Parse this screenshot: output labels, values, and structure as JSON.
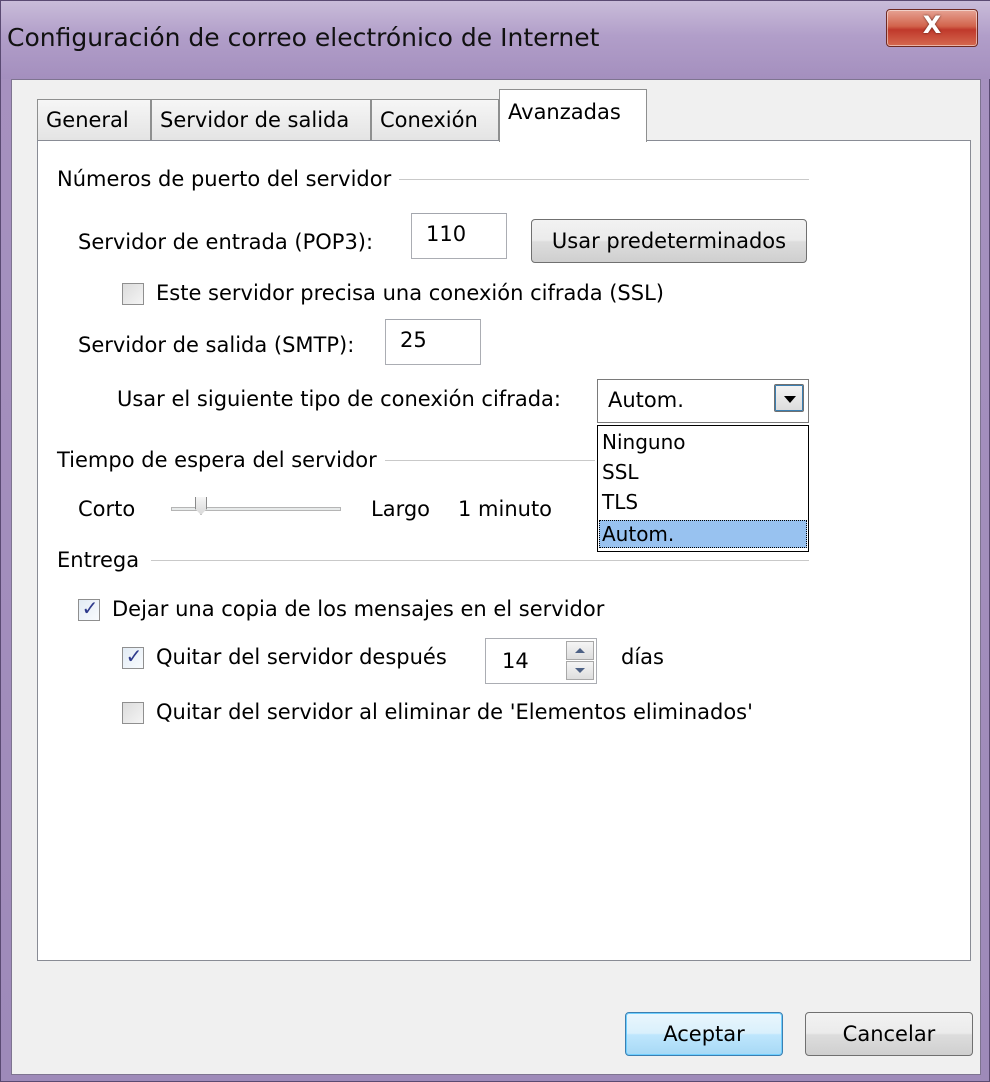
{
  "window": {
    "title": "Configuración de correo electrónico de Internet",
    "close_label": "X"
  },
  "tabs": [
    {
      "label": "General",
      "active": false
    },
    {
      "label": "Servidor de salida",
      "active": false
    },
    {
      "label": "Conexión",
      "active": false
    },
    {
      "label": "Avanzadas",
      "active": true
    }
  ],
  "ports": {
    "group_label": "Números de puerto del servidor",
    "incoming_label": "Servidor de entrada (POP3):",
    "incoming_value": "110",
    "defaults_button": "Usar predeterminados",
    "ssl_checkbox_label": "Este servidor precisa una conexión cifrada (SSL)",
    "ssl_checked": false,
    "outgoing_label": "Servidor de salida (SMTP):",
    "outgoing_value": "25",
    "encryption_label": "Usar el siguiente tipo de conexión cifrada:",
    "encryption_selected": "Autom.",
    "encryption_options": [
      "Ninguno",
      "SSL",
      "TLS",
      "Autom."
    ]
  },
  "timeout": {
    "group_label": "Tiempo de espera del servidor",
    "short_label": "Corto",
    "long_label": "Largo",
    "value_label": "1 minuto",
    "slider_level": 0.15
  },
  "delivery": {
    "group_label": "Entrega",
    "leave_copy_label": "Dejar una copia de los mensajes en el servidor",
    "leave_copy_checked": true,
    "remove_after_label": "Quitar del servidor después",
    "remove_after_checked": true,
    "remove_after_days": "14",
    "days_label": "días",
    "remove_on_delete_label": "Quitar del servidor al eliminar de 'Elementos eliminados'",
    "remove_on_delete_checked": false
  },
  "footer": {
    "ok_button": "Aceptar",
    "cancel_button": "Cancelar"
  }
}
